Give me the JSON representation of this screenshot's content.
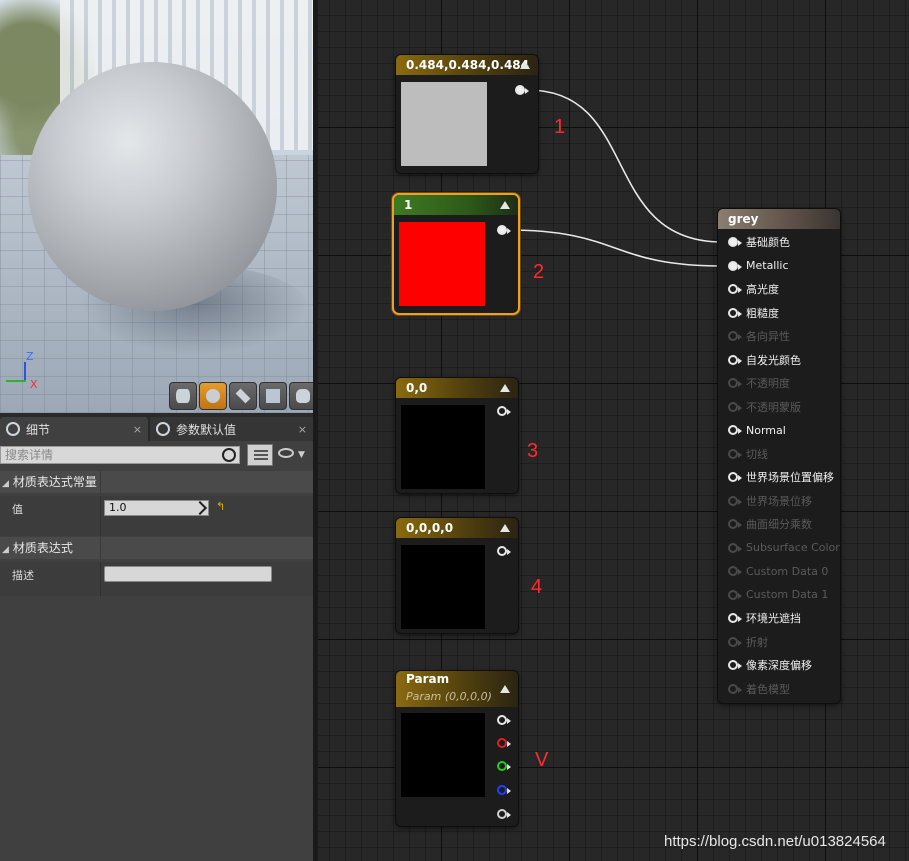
{
  "viewport": {
    "axis_z": "Z",
    "axis_x": "X",
    "preview_buttons": [
      "cylinder-icon",
      "sphere-icon",
      "plane-icon",
      "cube-icon",
      "teapot-icon"
    ],
    "active_button": "sphere-icon"
  },
  "details": {
    "tabs": [
      {
        "label": "细节",
        "close": "×"
      },
      {
        "label": "参数默认值",
        "close": "×"
      }
    ],
    "search_placeholder": "搜索详情",
    "sections": [
      {
        "title": "材质表达式常量",
        "rows": [
          {
            "label": "值",
            "value": "1.0"
          }
        ]
      },
      {
        "title": "材质表达式",
        "rows": [
          {
            "label": "描述",
            "value": ""
          }
        ]
      }
    ],
    "reset_glyph": "↰"
  },
  "graph": {
    "nodes": [
      {
        "title": "0.484,0.484,0.484",
        "preview_color": "#bdbdbd",
        "header": "gold"
      },
      {
        "title": "1",
        "preview_color": "#ff0000",
        "header": "green",
        "selected": true
      },
      {
        "title": "0,0",
        "preview_color": "#000000",
        "header": "gold"
      },
      {
        "title": "0,0,0,0",
        "preview_color": "#000000",
        "header": "gold"
      },
      {
        "title": "Param",
        "subtitle": "Param (0,0,0,0)",
        "preview_color": "#000000",
        "header": "gold",
        "pin_colors": [
          "#e8e8e8",
          "#e02020",
          "#20d020",
          "#2040ff",
          "#cfcfcf"
        ]
      }
    ],
    "result_node": {
      "title": "grey",
      "inputs": [
        {
          "label": "基础颜色",
          "enabled": true,
          "connected": true
        },
        {
          "label": "Metallic",
          "enabled": true,
          "connected": true
        },
        {
          "label": "高光度",
          "enabled": true,
          "connected": false
        },
        {
          "label": "粗糙度",
          "enabled": true,
          "connected": false
        },
        {
          "label": "各向异性",
          "enabled": false,
          "connected": false
        },
        {
          "label": "自发光颜色",
          "enabled": true,
          "connected": false
        },
        {
          "label": "不透明度",
          "enabled": false,
          "connected": false
        },
        {
          "label": "不透明蒙版",
          "enabled": false,
          "connected": false
        },
        {
          "label": "Normal",
          "enabled": true,
          "connected": false
        },
        {
          "label": "切线",
          "enabled": false,
          "connected": false
        },
        {
          "label": "世界场景位置偏移",
          "enabled": true,
          "connected": false
        },
        {
          "label": "世界场景位移",
          "enabled": false,
          "connected": false
        },
        {
          "label": "曲面细分乘数",
          "enabled": false,
          "connected": false
        },
        {
          "label": "Subsurface Color",
          "enabled": false,
          "connected": false
        },
        {
          "label": "Custom Data 0",
          "enabled": false,
          "connected": false
        },
        {
          "label": "Custom Data 1",
          "enabled": false,
          "connected": false
        },
        {
          "label": "环境光遮挡",
          "enabled": true,
          "connected": false
        },
        {
          "label": "折射",
          "enabled": false,
          "connected": false
        },
        {
          "label": "像素深度偏移",
          "enabled": true,
          "connected": false
        },
        {
          "label": "着色模型",
          "enabled": false,
          "connected": false
        }
      ]
    },
    "annotations": [
      "1",
      "2",
      "3",
      "4",
      "V"
    ],
    "wire_color": "#e8e8e8"
  },
  "watermark": "https://blog.csdn.net/u013824564"
}
